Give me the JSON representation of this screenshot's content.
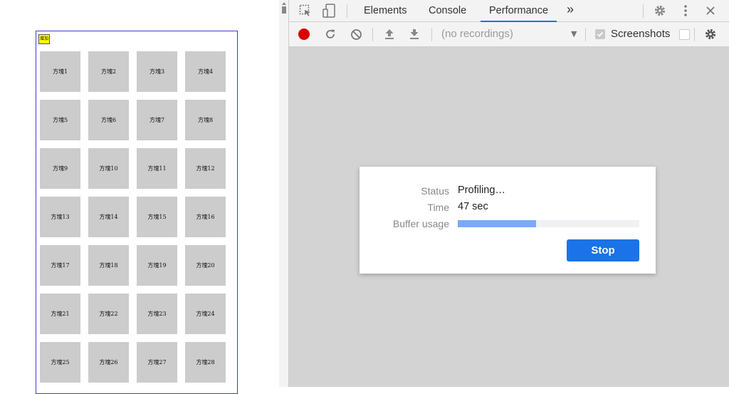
{
  "page": {
    "add_button_label": "增加",
    "boxes": [
      "方塊1",
      "方塊2",
      "方塊3",
      "方塊4",
      "方塊5",
      "方塊6",
      "方塊7",
      "方塊8",
      "方塊9",
      "方塊10",
      "方塊11",
      "方塊12",
      "方塊13",
      "方塊14",
      "方塊15",
      "方塊16",
      "方塊17",
      "方塊18",
      "方塊19",
      "方塊20",
      "方塊21",
      "方塊22",
      "方塊23",
      "方塊24",
      "方塊25",
      "方塊26",
      "方塊27",
      "方塊28"
    ]
  },
  "devtools": {
    "tabs": [
      {
        "label": "Elements",
        "active": false
      },
      {
        "label": "Console",
        "active": false
      },
      {
        "label": "Performance",
        "active": true
      }
    ],
    "more_tabs_label": "»",
    "toolbar": {
      "recordings_placeholder": "(no recordings)",
      "screenshots_label": "Screenshots",
      "screenshots_checked": true
    },
    "dialog": {
      "status_label": "Status",
      "status_value": "Profiling…",
      "time_label": "Time",
      "time_value": "47 sec",
      "buffer_label": "Buffer usage",
      "buffer_fraction": 0.43,
      "stop_label": "Stop"
    },
    "colors": {
      "accent": "#1a73e8",
      "record": "#d90000",
      "buffer_fill": "#7aa9f7",
      "panel_bg": "#d3d3d3"
    }
  }
}
